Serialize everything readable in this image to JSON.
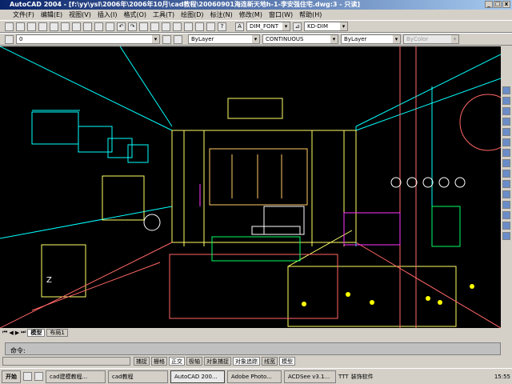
{
  "window": {
    "title": "AutoCAD 2004 - [f:\\yy\\ysl\\2006年\\2006年10月\\cad教程\\20060901海连新天地h-1-李安强住宅.dwg:3 - 只读]"
  },
  "menu": [
    "文件(F)",
    "编辑(E)",
    "视图(V)",
    "插入(I)",
    "格式(O)",
    "工具(T)",
    "绘图(D)",
    "标注(N)",
    "修改(M)",
    "窗口(W)",
    "帮助(H)"
  ],
  "toolbar": {
    "text_style": "DIM_FONT",
    "dim_style": "KD-DIM"
  },
  "properties": {
    "layer": "0",
    "color": "ByLayer",
    "linetype": "CONTINUOUS",
    "lineweight": "ByLayer",
    "plotstyle": "ByColor"
  },
  "tabs": [
    "模型",
    "布局1"
  ],
  "command": {
    "prompt": "命令:"
  },
  "status": [
    "捕捉",
    "栅格",
    "正交",
    "极轴",
    "对象捕捉",
    "对象追踪",
    "线宽",
    "模型"
  ],
  "taskbar": {
    "start": "开始",
    "tasks": [
      "cad建模教程...",
      "cad教程",
      "AutoCAD 200...",
      "Adobe Photo...",
      "ACDSee v3.1..."
    ],
    "tray_text": "TTT",
    "tray_app": "装饰软件",
    "clock": "15:55"
  }
}
